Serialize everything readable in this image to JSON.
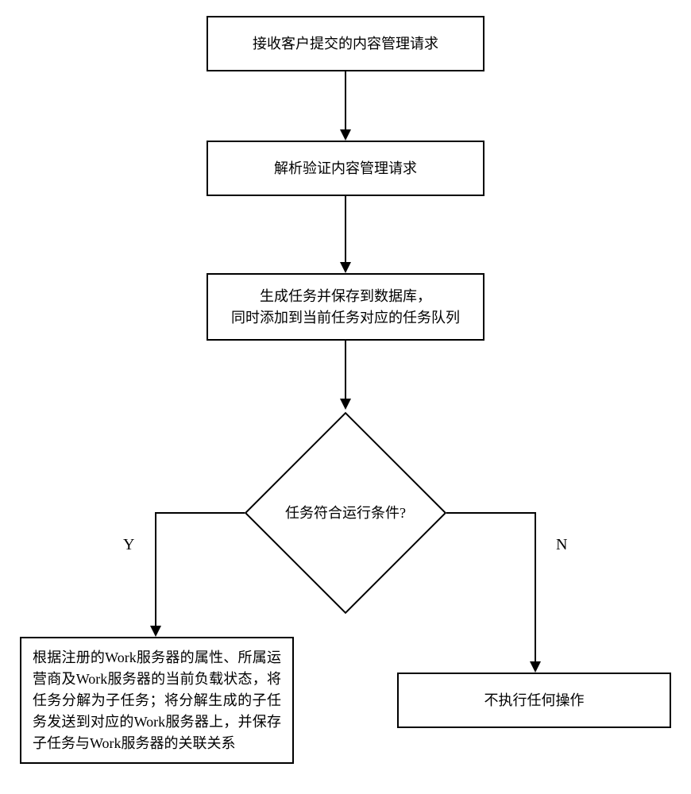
{
  "chart_data": {
    "type": "flowchart",
    "nodes": [
      {
        "id": "n1",
        "type": "process",
        "text": "接收客户提交的内容管理请求"
      },
      {
        "id": "n2",
        "type": "process",
        "text": "解析验证内容管理请求"
      },
      {
        "id": "n3",
        "type": "process",
        "text": "生成任务并保存到数据库，\n同时添加到当前任务对应的任务队列"
      },
      {
        "id": "d1",
        "type": "decision",
        "text": "任务符合运行条件?"
      },
      {
        "id": "n4",
        "type": "process",
        "text": "根据注册的Work服务器的属性、所属运营商及Work服务器的当前负载状态，将任务分解为子任务；将分解生成的子任务发送到对应的Work服务器上，并保存子任务与Work服务器的关联关系"
      },
      {
        "id": "n5",
        "type": "process",
        "text": "不执行任何操作"
      }
    ],
    "edges": [
      {
        "from": "n1",
        "to": "n2"
      },
      {
        "from": "n2",
        "to": "n3"
      },
      {
        "from": "n3",
        "to": "d1"
      },
      {
        "from": "d1",
        "to": "n4",
        "label": "Y"
      },
      {
        "from": "d1",
        "to": "n5",
        "label": "N"
      }
    ]
  },
  "nodes": {
    "n1": "接收客户提交的内容管理请求",
    "n2": "解析验证内容管理请求",
    "n3_line1": "生成任务并保存到数据库，",
    "n3_line2": "同时添加到当前任务对应的任务队列",
    "d1": "任务符合运行条件?",
    "n4": "根据注册的Work服务器的属性、所属运营商及Work服务器的当前负载状态，将任务分解为子任务；将分解生成的子任务发送到对应的Work服务器上，并保存子任务与Work服务器的关联关系",
    "n5": "不执行任何操作"
  },
  "labels": {
    "yes": "Y",
    "no": "N"
  }
}
